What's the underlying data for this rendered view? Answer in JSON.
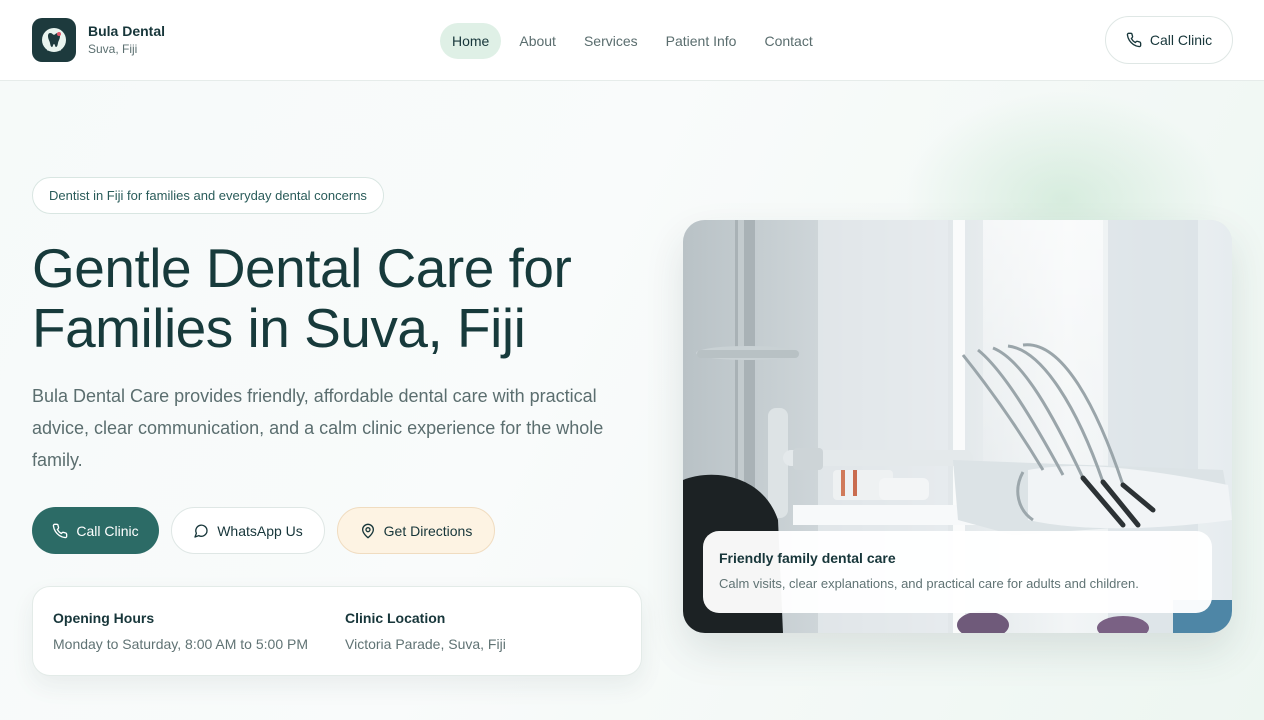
{
  "brand": {
    "name": "Bula Dental",
    "location": "Suva, Fiji"
  },
  "nav": {
    "items": [
      {
        "label": "Home",
        "active": true
      },
      {
        "label": "About",
        "active": false
      },
      {
        "label": "Services",
        "active": false
      },
      {
        "label": "Patient Info",
        "active": false
      },
      {
        "label": "Contact",
        "active": false
      }
    ]
  },
  "header": {
    "call_label": "Call Clinic"
  },
  "hero": {
    "badge": "Dentist in Fiji for families and everyday dental concerns",
    "title": "Gentle Dental Care for Families in Suva, Fiji",
    "description": "Bula Dental Care provides friendly, affordable dental care with practical advice, clear communication, and a calm clinic experience for the whole family.",
    "buttons": {
      "call": "Call Clinic",
      "whatsapp": "WhatsApp Us",
      "directions": "Get Directions"
    },
    "info": {
      "hours_label": "Opening Hours",
      "hours_value": "Monday to Saturday, 8:00 AM to 5:00 PM",
      "location_label": "Clinic Location",
      "location_value": "Victoria Parade, Suva, Fiji"
    }
  },
  "photo_card": {
    "title": "Friendly family dental care",
    "text": "Calm visits, clear explanations, and practical care for adults and children."
  },
  "icons": {
    "logo": "tooth-logo-icon",
    "phone": "phone-icon",
    "chat": "chat-bubble-icon",
    "location": "map-pin-icon"
  },
  "colors": {
    "primary": "#2c6b66",
    "dark_text": "#17363a",
    "nav_active_bg": "#dff0e6",
    "directions_bg": "#fdf3e3"
  }
}
